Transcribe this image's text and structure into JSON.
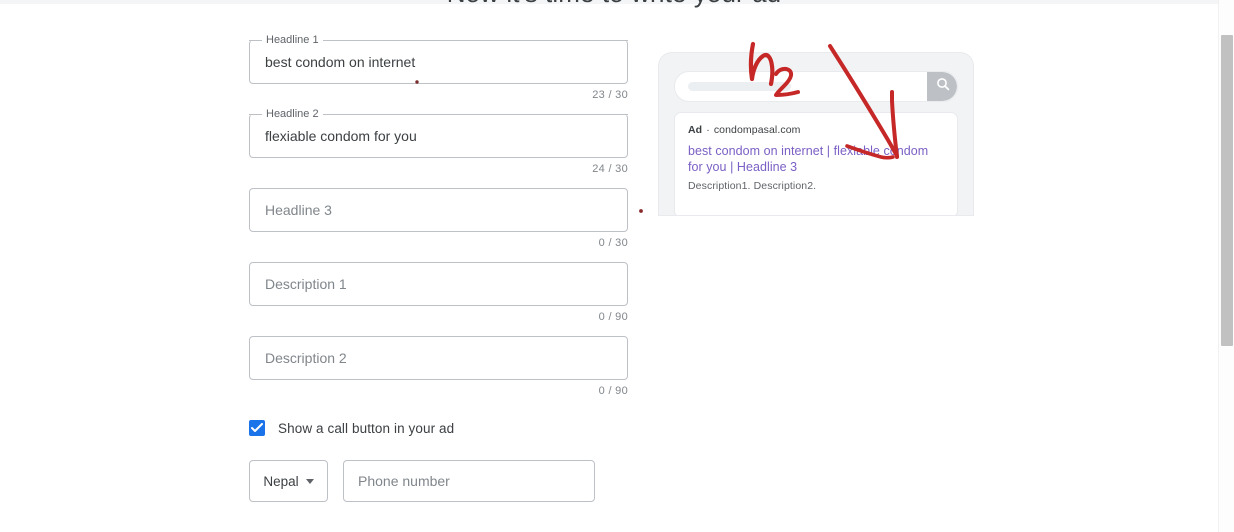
{
  "page": {
    "title": "Now it's time to write your ad"
  },
  "form": {
    "headline1": {
      "label": "Headline 1",
      "value": "best condom on internet",
      "counter": "23 / 30"
    },
    "headline2": {
      "label": "Headline 2",
      "value": "flexiable condom for you",
      "counter": "24 / 30"
    },
    "headline3": {
      "label": "Headline 3",
      "placeholder": "Headline 3",
      "value": "",
      "counter": "0 / 30"
    },
    "description1": {
      "label": "Description 1",
      "placeholder": "Description 1",
      "value": "",
      "counter": "0 / 90"
    },
    "description2": {
      "label": "Description 2",
      "placeholder": "Description 2",
      "value": "",
      "counter": "0 / 90"
    },
    "call_button": {
      "label": "Show a call button in your ad",
      "checked": "true",
      "check_icon": "checkmark-icon"
    },
    "country": {
      "value": "Nepal",
      "caret_icon": "caret-down-icon"
    },
    "phone": {
      "placeholder": "Phone number",
      "value": ""
    }
  },
  "preview": {
    "search_bar": {
      "search_icon": "search-icon",
      "query": ""
    },
    "ad": {
      "ad_label": "Ad",
      "separator": "·",
      "domain": "condompasal.com",
      "headline": "best condom on internet | flexiable condom for you | Headline 3",
      "description": "Description1. Description2."
    }
  },
  "annotations": {
    "handwritten_label": "h2",
    "ink_color": "#c62828",
    "marks": [
      "handwritten-h2-label",
      "diagonal-arrow-to-headline",
      "check-stroke-under-headline",
      "dot-after-headline1-value",
      "dot-between-columns"
    ]
  },
  "colors": {
    "accent": "#1a73e8",
    "field_border": "#bdc1c6",
    "text_primary": "#3c4043",
    "text_secondary": "#5f6368",
    "placeholder": "#80868b",
    "ad_link": "#7b5fc4",
    "annotation_red": "#c62828",
    "scrollbar_thumb": "#c1c1c1"
  },
  "scrollbar": {
    "orientation": "vertical",
    "thumb_present": "true"
  }
}
